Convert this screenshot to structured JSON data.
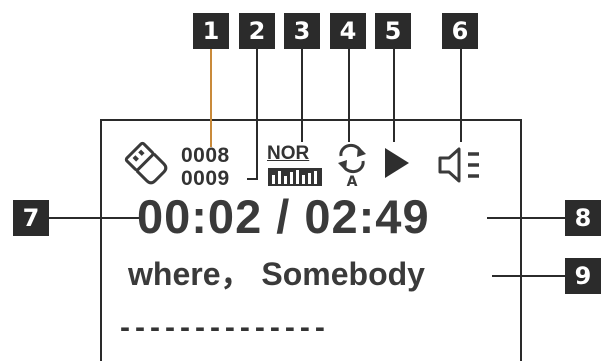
{
  "callouts": [
    "1",
    "2",
    "3",
    "4",
    "5",
    "6",
    "7",
    "8",
    "9"
  ],
  "display": {
    "track_current": "0008",
    "track_total": "0009",
    "eq_mode": "NOR",
    "time": "00:02 / 02:49",
    "song_title": "where， Somebody",
    "dashes": "--------------"
  },
  "icons": {
    "storage": "usb-stick-icon",
    "repeat": "repeat-all-icon",
    "play_status": "play-icon",
    "volume": "volume-icon"
  },
  "colors": {
    "callout_bg": "#2b2b2b",
    "text": "#3a3a3a"
  }
}
